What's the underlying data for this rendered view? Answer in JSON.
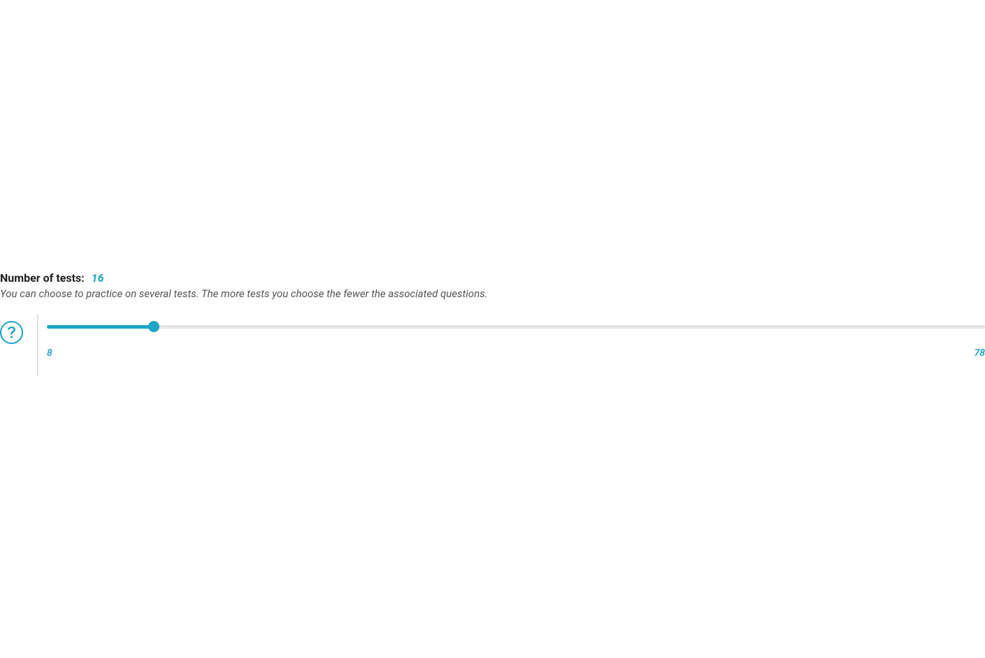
{
  "slider": {
    "title_label": "Number of tests:",
    "value": "16",
    "description": "You can choose to practice on several tests. The more tests you choose the fewer the associated questions.",
    "min_label": "8",
    "max_label": "78",
    "min": 8,
    "max": 78,
    "current": 16
  },
  "colors": {
    "accent": "#1ca4c9",
    "text_primary": "#222222",
    "text_secondary": "#555555",
    "track": "#e5e5e5"
  }
}
